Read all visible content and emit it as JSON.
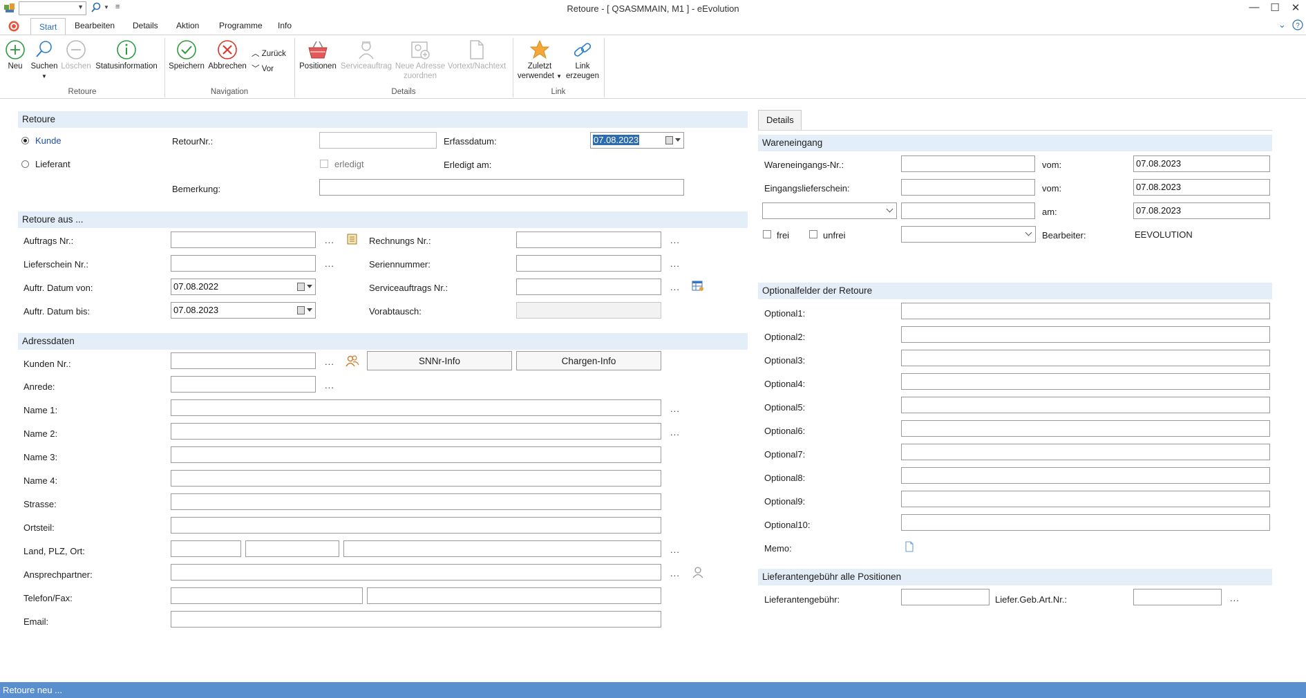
{
  "window": {
    "title": "Retoure - [ QSASMMAIN, M1 ]  -  eEvolution",
    "minimize": "—",
    "maximize": "☐",
    "close": "✕"
  },
  "tabs": [
    {
      "label": "Start"
    },
    {
      "label": "Bearbeiten"
    },
    {
      "label": "Details"
    },
    {
      "label": "Aktion"
    },
    {
      "label": "Programme"
    },
    {
      "label": "Info"
    }
  ],
  "ribbon": {
    "neu": "Neu",
    "suchen": "Suchen",
    "loeschen": "Löschen",
    "statusinformation": "Statusinformation",
    "group_retoure": "Retoure",
    "speichern": "Speichern",
    "abbrechen": "Abbrechen",
    "zurueck": "Zurück",
    "vor": "Vor",
    "group_navigation": "Navigation",
    "positionen": "Positionen",
    "serviceauftrag": "Serviceauftrag",
    "neue_adresse_1": "Neue Adresse",
    "neue_adresse_2": "zuordnen",
    "vortext": "Vortext/Nachtext",
    "group_details": "Details",
    "zuletzt_1": "Zuletzt",
    "zuletzt_2": "verwendet",
    "link_1": "Link",
    "link_2": "erzeugen",
    "group_link": "Link"
  },
  "retoure": {
    "header": "Retoure",
    "kunde": "Kunde",
    "lieferant": "Lieferant",
    "retournr_label": "RetourNr.:",
    "retournr_value": "",
    "erfassdatum_label": "Erfassdatum:",
    "erfassdatum_value": "07.08.2023",
    "erledigt": "erledigt",
    "erledigt_am_label": "Erledigt am:",
    "bemerkung_label": "Bemerkung:",
    "bemerkung_value": ""
  },
  "retoure_aus": {
    "header": "Retoure aus ...",
    "auftrags_nr": "Auftrags Nr.:",
    "lieferschein_nr": "Lieferschein Nr.:",
    "auftr_datum_von": "Auftr. Datum von:",
    "auftr_datum_von_value": "07.08.2022",
    "auftr_datum_bis": "Auftr. Datum bis:",
    "auftr_datum_bis_value": "07.08.2023",
    "rechnungs_nr": "Rechnungs Nr.:",
    "seriennummer": "Seriennummer:",
    "serviceauftrags_nr": "Serviceauftrags Nr.:",
    "vorabtausch": "Vorabtausch:",
    "dots": "..."
  },
  "adressdaten": {
    "header": "Adressdaten",
    "kunden_nr": "Kunden Nr.:",
    "snnr_info": "SNNr-Info",
    "chargen_info": "Chargen-Info",
    "anrede": "Anrede:",
    "name1": "Name 1:",
    "name2": "Name 2:",
    "name3": "Name 3:",
    "name4": "Name 4:",
    "strasse": "Strasse:",
    "ortsteil": "Ortsteil:",
    "land_plz_ort": "Land, PLZ, Ort:",
    "ansprechpartner": "Ansprechpartner:",
    "telefon_fax": "Telefon/Fax:",
    "email": "Email:"
  },
  "details_tab": "Details",
  "wareneingang": {
    "header": "Wareneingang",
    "wareneingangs_nr": "Wareneingangs-Nr.:",
    "vom1": "vom:",
    "vom1_value": "07.08.2023",
    "eingangslieferschein": "Eingangslieferschein:",
    "vom2": "vom:",
    "vom2_value": "07.08.2023",
    "am": "am:",
    "am_value": "07.08.2023",
    "frei": "frei",
    "unfrei": "unfrei",
    "bearbeiter": "Bearbeiter:",
    "bearbeiter_value": "EEVOLUTION"
  },
  "optional": {
    "header": "Optionalfelder der Retoure",
    "labels": [
      "Optional1:",
      "Optional2:",
      "Optional3:",
      "Optional4:",
      "Optional5:",
      "Optional6:",
      "Optional7:",
      "Optional8:",
      "Optional9:",
      "Optional10:"
    ],
    "memo": "Memo:"
  },
  "lieferantengebuehr": {
    "header": "Lieferantengebühr alle Positionen",
    "label": "Lieferantengebühr:",
    "art_label": "Liefer.Geb.Art.Nr.:",
    "dots": "..."
  },
  "status": "Retoure neu ...",
  "colors": {
    "accent": "#2b6cb0",
    "section_bg": "#e4eef8",
    "statusbar": "#5a8fcf"
  }
}
